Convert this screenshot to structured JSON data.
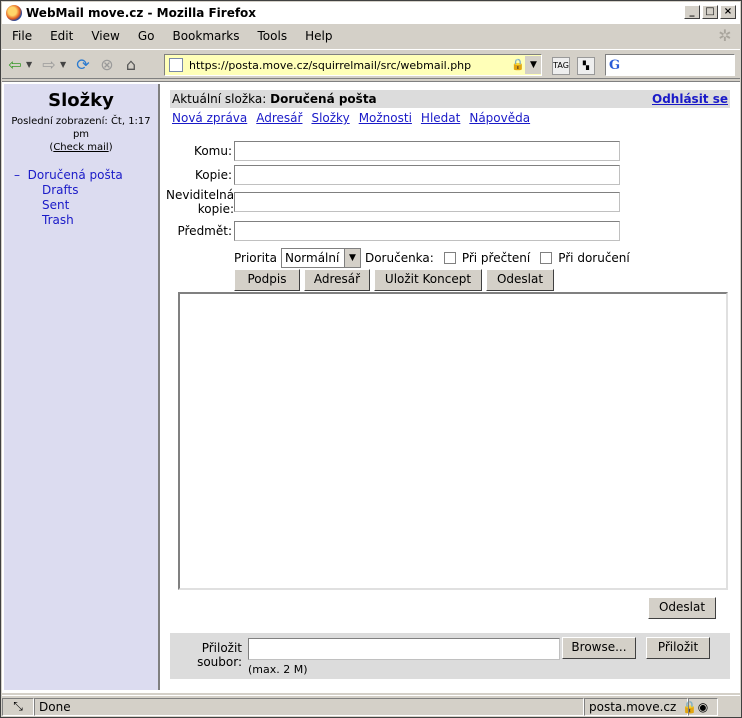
{
  "window": {
    "title": "WebMail move.cz - Mozilla Firefox"
  },
  "menu": [
    "File",
    "Edit",
    "View",
    "Go",
    "Bookmarks",
    "Tools",
    "Help"
  ],
  "nav": {
    "url": "https://posta.move.cz/squirrelmail/src/webmail.php",
    "search_placeholder": ""
  },
  "sidebar": {
    "title": "Složky",
    "last_refresh": "Poslední zobrazení: Čt, 1:17 pm",
    "check_mail": "Check mail",
    "folders": [
      {
        "prefix": "–",
        "label": "Doručená pošta"
      },
      {
        "label": "Drafts"
      },
      {
        "label": "Sent"
      },
      {
        "label": "Trash"
      }
    ]
  },
  "header": {
    "current_label": "Aktuální složka:",
    "current_folder": "Doručená pošta",
    "logout": "Odhlásit se"
  },
  "links": [
    "Nová zpráva",
    "Adresář",
    "Složky",
    "Možnosti",
    "Hledat",
    "Nápověda"
  ],
  "compose": {
    "to_label": "Komu:",
    "cc_label": "Kopie:",
    "bcc_label_1": "Neviditelná",
    "bcc_label_2": "kopie:",
    "subject_label": "Předmět:",
    "to_value": "",
    "cc_value": "",
    "bcc_value": "",
    "subject_value": "",
    "priority_label": "Priorita",
    "priority_value": "Normální",
    "receipt_label": "Doručenka:",
    "receipt_read": "Při přečtení",
    "receipt_delivery": "Při doručení",
    "buttons": {
      "signature": "Podpis",
      "address_book": "Adresář",
      "save_draft": "Uložit Koncept",
      "send": "Odeslat"
    },
    "send_bottom": "Odeslat"
  },
  "attach": {
    "label_1": "Přiložit",
    "label_2": "soubor:",
    "max": "(max. 2 M)",
    "browse": "Browse...",
    "attach_button": "Přiložit"
  },
  "status": {
    "text": "Done",
    "host": "posta.move.cz"
  }
}
